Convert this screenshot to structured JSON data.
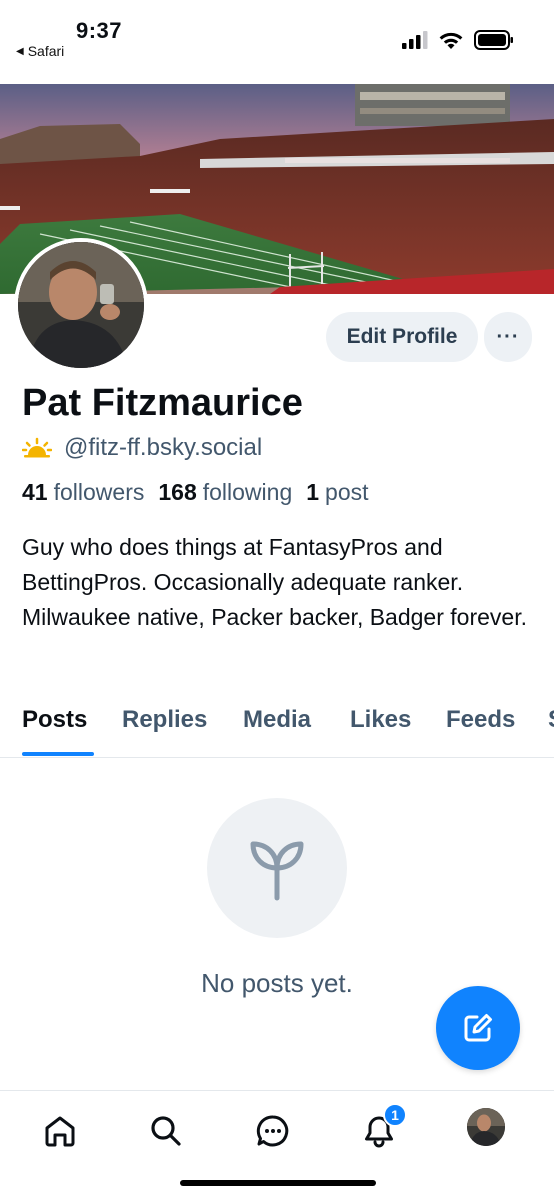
{
  "status_bar": {
    "time": "9:37",
    "back_app": "Safari",
    "icons": [
      "cellular-signal-icon",
      "wifi-icon",
      "battery-icon"
    ]
  },
  "profile": {
    "banner": "stadium-photo",
    "avatar": "profile-photo",
    "edit_label": "Edit Profile",
    "more_label": "···",
    "display_name": "Pat Fitzmaurice",
    "handle_icon": "sun-icon",
    "handle": "@fitz-ff.bsky.social",
    "followers_count": "41",
    "followers_label": "followers",
    "following_count": "168",
    "following_label": "following",
    "posts_count": "1",
    "posts_label": "post",
    "bio": "Guy who does things at FantasyPros and BettingPros. Occasionally adequate ranker. Milwaukee native, Packer backer, Badger forever."
  },
  "tabs": [
    {
      "label": "Posts",
      "active": true
    },
    {
      "label": "Replies",
      "active": false
    },
    {
      "label": "Media",
      "active": false
    },
    {
      "label": "Likes",
      "active": false
    },
    {
      "label": "Feeds",
      "active": false
    },
    {
      "label": "S",
      "active": false
    }
  ],
  "empty_state": {
    "icon": "seedling-icon",
    "message": "No posts yet."
  },
  "compose_button": {
    "icon": "compose-icon"
  },
  "bottom_nav": {
    "items": [
      "home-icon",
      "search-icon",
      "chat-icon",
      "bell-icon",
      "profile-avatar"
    ],
    "notification_badge": "1"
  },
  "colors": {
    "accent": "#1083fe",
    "text_primary": "#0b0f14",
    "text_secondary": "#42576c",
    "button_bg": "#edf1f5"
  }
}
